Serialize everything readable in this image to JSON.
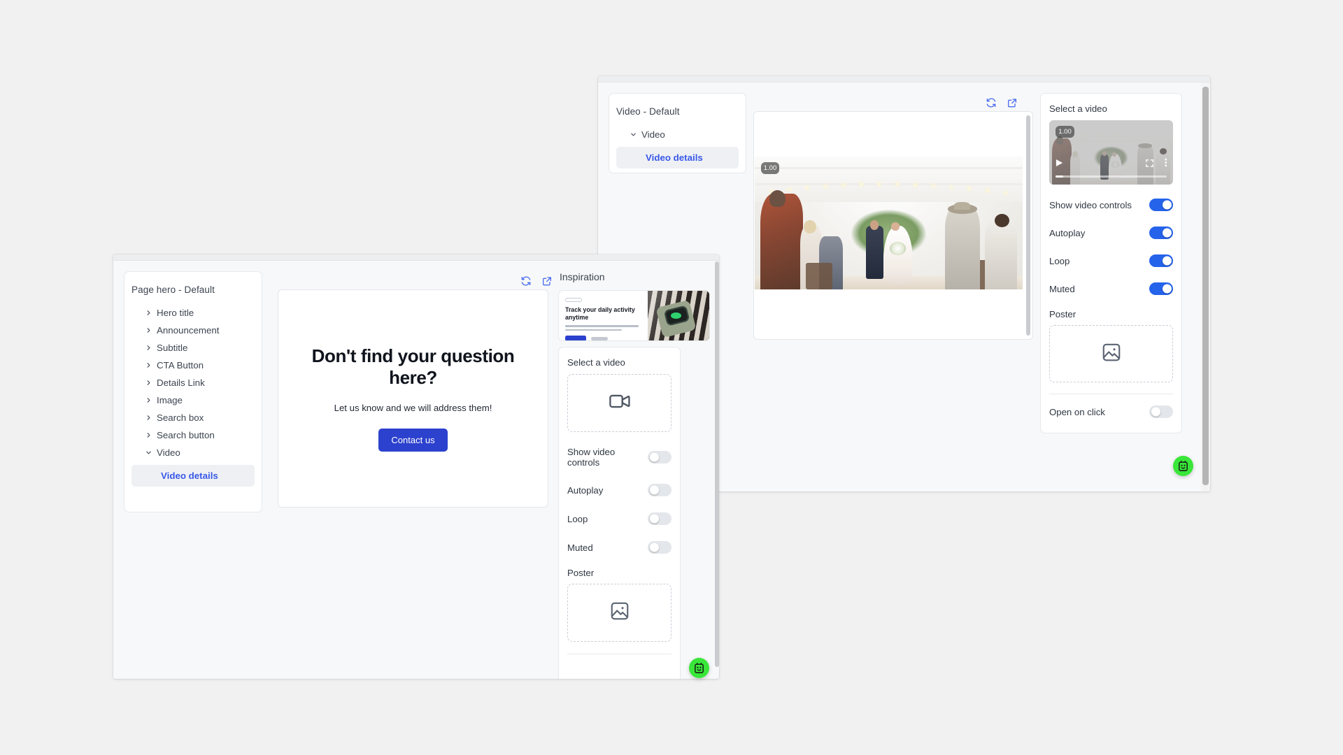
{
  "app": {
    "background_color": "#f1f1f1",
    "accent_color": "#2563eb",
    "link_color": "#3858e9",
    "bot_color": "#39e639"
  },
  "window_back": {
    "tree": {
      "title": "Video - Default",
      "nodes": [
        {
          "label": "Video",
          "expanded": true
        }
      ],
      "child": "Video details"
    },
    "preview": {
      "refresh_icon": "refresh-icon",
      "open_external_icon": "open-external-icon",
      "video_badge": "1.00"
    },
    "inspector": {
      "select_video_label": "Select a video",
      "video_thumb_badge": "1.00",
      "toggles": [
        {
          "label": "Show video controls",
          "on": true
        },
        {
          "label": "Autoplay",
          "on": true
        },
        {
          "label": "Loop",
          "on": true
        },
        {
          "label": "Muted",
          "on": true
        }
      ],
      "poster_label": "Poster",
      "poster_icon": "image-placeholder-icon",
      "open_on_click_label": "Open on click",
      "open_on_click_on": false
    },
    "bot_icon": "chat-bot-icon"
  },
  "window_front": {
    "tree": {
      "title": "Page hero - Default",
      "nodes": [
        {
          "label": "Hero title",
          "expanded": false
        },
        {
          "label": "Announcement",
          "expanded": false
        },
        {
          "label": "Subtitle",
          "expanded": false
        },
        {
          "label": "CTA Button",
          "expanded": false
        },
        {
          "label": "Details Link",
          "expanded": false
        },
        {
          "label": "Image",
          "expanded": false
        },
        {
          "label": "Search box",
          "expanded": false
        },
        {
          "label": "Search button",
          "expanded": false
        },
        {
          "label": "Video",
          "expanded": true
        }
      ],
      "child": "Video details"
    },
    "preview": {
      "refresh_icon": "refresh-icon",
      "open_external_icon": "open-external-icon",
      "hero_title": "Don't find your question here?",
      "hero_subtitle": "Let us know and we will address them!",
      "hero_button": "Contact us"
    },
    "inspiration": {
      "title": "Inspiration",
      "card_heading": "Track your daily activity anytime",
      "card_image": "smartwatch-on-wrist-photo"
    },
    "inspector": {
      "select_video_label": "Select a video",
      "video_dropzone_icon": "video-camera-icon",
      "toggles": [
        {
          "label": "Show video controls",
          "on": false
        },
        {
          "label": "Autoplay",
          "on": false
        },
        {
          "label": "Loop",
          "on": false
        },
        {
          "label": "Muted",
          "on": false
        }
      ],
      "poster_label": "Poster",
      "poster_icon": "image-placeholder-icon"
    },
    "bot_icon": "chat-bot-icon"
  }
}
